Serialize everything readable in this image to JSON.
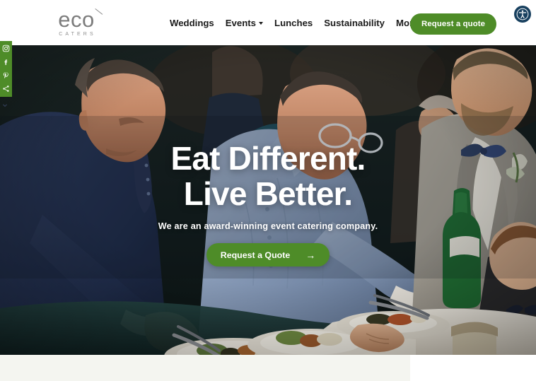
{
  "brand": {
    "logo_word": "eco",
    "logo_sub": "CATERS",
    "accent_green": "#4e8c28",
    "a11y_navy": "#18405f",
    "logo_gray": "#7d7d7d"
  },
  "header": {
    "nav": [
      {
        "label": "Weddings",
        "has_dropdown": false
      },
      {
        "label": "Events",
        "has_dropdown": true
      },
      {
        "label": "Lunches",
        "has_dropdown": false
      },
      {
        "label": "Sustainability",
        "has_dropdown": false
      },
      {
        "label": "More",
        "has_dropdown": true
      }
    ],
    "cta_label": "Request a quote",
    "a11y_icon": "accessibility-icon"
  },
  "social_rail": {
    "items": [
      {
        "icon": "instagram-icon",
        "label": "Instagram"
      },
      {
        "icon": "facebook-icon",
        "label": "Facebook"
      },
      {
        "icon": "pinterest-icon",
        "label": "Pinterest"
      },
      {
        "icon": "share-icon",
        "label": "Share"
      }
    ],
    "collapse_icon": "chevron-down-icon",
    "background": "#4e8c28"
  },
  "hero": {
    "headline_line1": "Eat Different.",
    "headline_line2": "Live Better.",
    "subtitle": "We are an award-winning event catering company.",
    "cta_label": "Request a Quote",
    "cta_arrow": "→",
    "photo_alt": "Catering staff plating appetizers at a wedding reception"
  },
  "below_fold": {
    "cream_color": "#f4f5f0",
    "white_color": "#ffffff"
  }
}
